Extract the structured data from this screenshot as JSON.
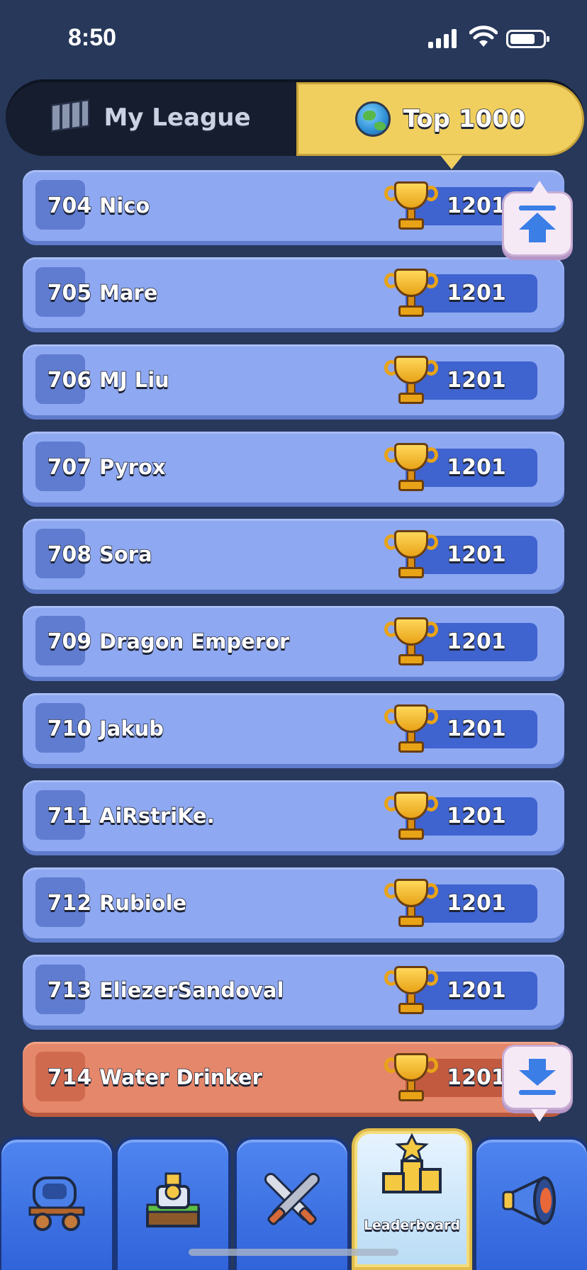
{
  "status_bar": {
    "time": "8:50"
  },
  "tabs": {
    "my_league": "My League",
    "top_1000": "Top 1000"
  },
  "rows": [
    {
      "rank": "704",
      "name": "Nico",
      "score": "1201",
      "me": false
    },
    {
      "rank": "705",
      "name": "Mare",
      "score": "1201",
      "me": false
    },
    {
      "rank": "706",
      "name": "MJ Liu",
      "score": "1201",
      "me": false
    },
    {
      "rank": "707",
      "name": "Pyrox",
      "score": "1201",
      "me": false
    },
    {
      "rank": "708",
      "name": "Sora",
      "score": "1201",
      "me": false
    },
    {
      "rank": "709",
      "name": "Dragon Emperor",
      "score": "1201",
      "me": false
    },
    {
      "rank": "710",
      "name": "Jakub",
      "score": "1201",
      "me": false
    },
    {
      "rank": "711",
      "name": "AiRstriKe.",
      "score": "1201",
      "me": false
    },
    {
      "rank": "712",
      "name": "Rubiole",
      "score": "1201",
      "me": false
    },
    {
      "rank": "713",
      "name": "EliezerSandoval",
      "score": "1201",
      "me": false
    },
    {
      "rank": "714",
      "name": "Water Drinker",
      "score": "1201",
      "me": true
    }
  ],
  "nav": {
    "items": [
      {
        "icon": "wagon-icon",
        "label": ""
      },
      {
        "icon": "tower-icon",
        "label": ""
      },
      {
        "icon": "crossed-swords-icon",
        "label": ""
      },
      {
        "icon": "podium-icon",
        "label": "Leaderboard"
      },
      {
        "icon": "megaphone-icon",
        "label": ""
      }
    ],
    "active_index": 3
  },
  "colors": {
    "row": "#8ea8f1",
    "row_me": "#e5876a",
    "tab_active": "#f0cf5e",
    "background": "#27385a"
  }
}
